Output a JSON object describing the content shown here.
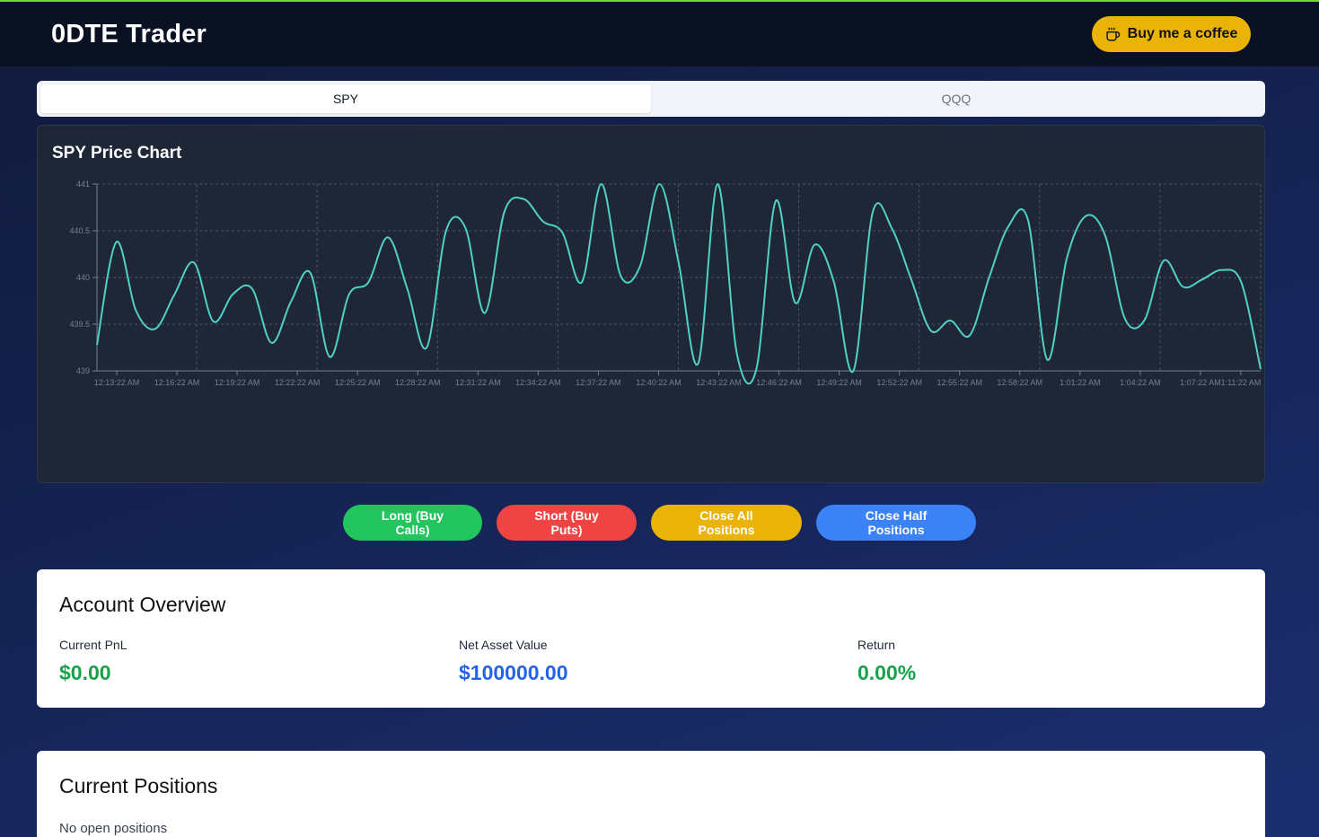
{
  "header": {
    "title": "0DTE Trader",
    "coffee_label": "Buy me a coffee"
  },
  "tabs": [
    {
      "label": "SPY",
      "active": true
    },
    {
      "label": "QQQ",
      "active": false
    }
  ],
  "chart": {
    "title": "SPY Price Chart"
  },
  "chart_data": {
    "type": "line",
    "title": "SPY Price Chart",
    "xlabel": "",
    "ylabel": "",
    "ylim": [
      439,
      441
    ],
    "grid": true,
    "line_color": "#4fd1c5",
    "y_ticks": [
      "441",
      "440.5",
      "440",
      "439.5",
      "439"
    ],
    "x_ticks": [
      "12:13:22 AM",
      "12:16:22 AM",
      "12:19:22 AM",
      "12:22:22 AM",
      "12:25:22 AM",
      "12:28:22 AM",
      "12:31:22 AM",
      "12:34:22 AM",
      "12:37:22 AM",
      "12:40:22 AM",
      "12:43:22 AM",
      "12:46:22 AM",
      "12:49:22 AM",
      "12:52:22 AM",
      "12:55:22 AM",
      "12:58:22 AM",
      "1:01:22 AM",
      "1:04:22 AM",
      "1:07:22 AM",
      "1:11:22 AM"
    ],
    "series": [
      {
        "values": [
          439.28,
          440.38,
          439.65,
          439.45,
          439.82,
          440.16,
          439.53,
          439.82,
          439.88,
          439.3,
          439.74,
          440.05,
          439.15,
          439.82,
          439.95,
          440.43,
          439.88,
          439.25,
          440.5,
          440.53,
          439.62,
          440.7,
          440.84,
          440.6,
          440.48,
          439.95,
          441.0,
          440.02,
          440.12,
          441.0,
          440.15,
          439.08,
          441.0,
          439.18,
          439.02,
          440.82,
          439.73,
          440.35,
          439.95,
          439.0,
          440.7,
          440.52,
          439.97,
          439.43,
          439.54,
          439.38,
          440.0,
          440.55,
          440.62,
          439.12,
          440.2,
          440.66,
          440.44,
          439.56,
          439.54,
          440.18,
          439.9,
          439.98,
          440.08,
          439.95,
          439.02
        ]
      }
    ]
  },
  "actions": {
    "long_label": "Long (Buy Calls)",
    "short_label": "Short (Buy Puts)",
    "close_all_label": "Close All Positions",
    "close_half_label": "Close Half Positions"
  },
  "account": {
    "title": "Account Overview",
    "pnl_label": "Current PnL",
    "pnl_value": "$0.00",
    "nav_label": "Net Asset Value",
    "nav_value": "$100000.00",
    "return_label": "Return",
    "return_value": "0.00%"
  },
  "positions": {
    "title": "Current Positions",
    "empty_message": "No open positions"
  }
}
